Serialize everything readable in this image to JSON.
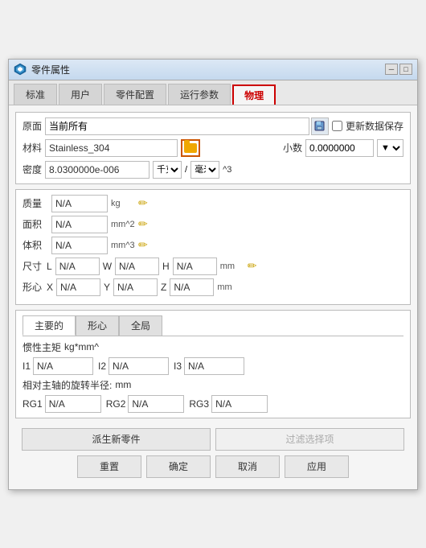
{
  "window": {
    "title": "零件属性",
    "minimize_label": "─",
    "maximize_label": "□",
    "close_label": "✕"
  },
  "tabs": [
    {
      "label": "标准",
      "active": false
    },
    {
      "label": "用户",
      "active": false
    },
    {
      "label": "零件配置",
      "active": false
    },
    {
      "label": "运行参数",
      "active": false
    },
    {
      "label": "物理",
      "active": true
    }
  ],
  "physical": {
    "origin_label": "原面",
    "origin_value": "当前所有",
    "material_label": "材料",
    "material_value": "Stainless_304",
    "density_label": "密度",
    "density_value": "8.0300000e-006",
    "density_unit1": "千克",
    "density_unit2": "毫米",
    "density_unit3": "^3",
    "update_data_label": "更新数据保存",
    "decimal_label": "小数",
    "decimal_value": "0.0000000",
    "mass_label": "质量",
    "mass_value": "N/A",
    "mass_unit": "kg",
    "area_label": "面积",
    "area_value": "N/A",
    "area_unit": "mm^2",
    "volume_label": "体积",
    "volume_value": "N/A",
    "volume_unit": "mm^3",
    "dim_label": "尺寸",
    "dim_L_label": "L",
    "dim_L_value": "N/A",
    "dim_W_label": "W",
    "dim_W_value": "N/A",
    "dim_H_label": "H",
    "dim_H_value": "N/A",
    "dim_unit": "mm",
    "centroid_label": "形心",
    "centroid_X_label": "X",
    "centroid_X_value": "N/A",
    "centroid_Y_label": "Y",
    "centroid_Y_value": "N/A",
    "centroid_Z_label": "Z",
    "centroid_Z_value": "N/A",
    "centroid_unit": "mm",
    "sub_tabs": [
      {
        "label": "主要的",
        "active": true
      },
      {
        "label": "形心",
        "active": false
      },
      {
        "label": "全局",
        "active": false
      }
    ],
    "inertia_label": "惯性主矩",
    "inertia_unit": "kg*mm^",
    "I1_label": "I1",
    "I1_value": "N/A",
    "I2_label": "I2",
    "I2_value": "N/A",
    "I3_label": "I3",
    "I3_value": "N/A",
    "radius_label": "相对主轴的旋转半径:",
    "radius_unit": "mm",
    "RG1_label": "RG1",
    "RG1_value": "N/A",
    "RG2_label": "RG2",
    "RG2_value": "N/A",
    "RG3_label": "RG3",
    "RG3_value": "N/A",
    "derive_btn": "派生新零件",
    "filter_btn": "过滤选择项",
    "reset_btn": "重置",
    "confirm_btn": "确定",
    "cancel_btn": "取消",
    "apply_btn": "应用"
  }
}
